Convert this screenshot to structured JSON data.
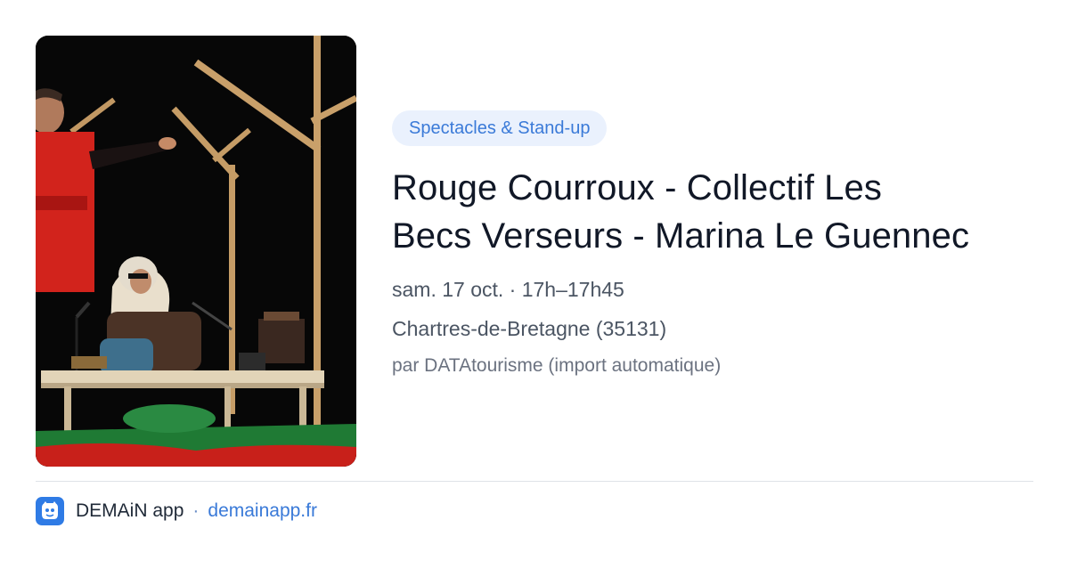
{
  "event": {
    "category": "Spectacles & Stand-up",
    "title_line1": "Rouge Courroux - Collectif Les",
    "title_line2": "Becs Verseurs - Marina Le Guennec",
    "datetime": "sam. 17 oct. · 17h–17h45",
    "location": "Chartres-de-Bretagne (35131)",
    "source": "par DATAtourisme (import automatique)"
  },
  "footer": {
    "app_name": "DEMAiN app",
    "separator": "·",
    "domain": "demainapp.fr"
  },
  "colors": {
    "accent": "#3a7ad8",
    "pill_bg": "#eaf1fd",
    "title": "#111827",
    "meta": "#4b5563",
    "logo_bg": "#2f7be5"
  },
  "icons": {
    "logo": "demain-app-logo-icon"
  }
}
